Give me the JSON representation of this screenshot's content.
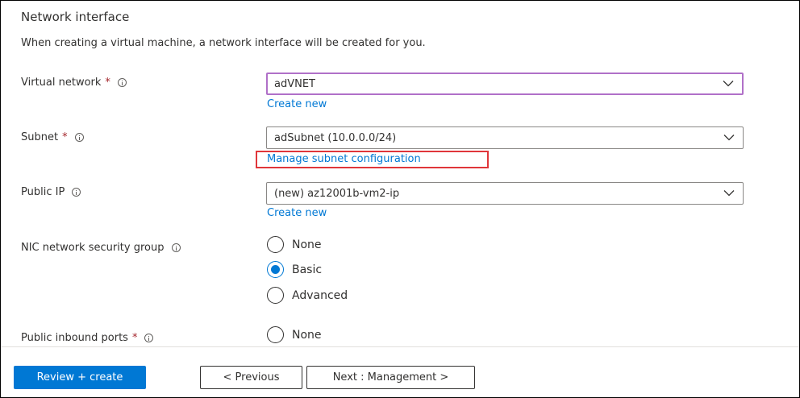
{
  "section": {
    "title": "Network interface",
    "description": "When creating a virtual machine, a network interface will be created for you."
  },
  "fields": {
    "virtual_network": {
      "label": "Virtual network",
      "required_mark": "*",
      "value": "adVNET",
      "link": "Create new"
    },
    "subnet": {
      "label": "Subnet",
      "required_mark": "*",
      "value": "adSubnet (10.0.0.0/24)",
      "link": "Manage subnet configuration"
    },
    "public_ip": {
      "label": "Public IP",
      "value": "(new) az12001b-vm2-ip",
      "link": "Create new"
    },
    "nic_nsg": {
      "label": "NIC network security group",
      "options": [
        "None",
        "Basic",
        "Advanced"
      ],
      "selected": "Basic"
    },
    "public_inbound_ports": {
      "label": "Public inbound ports",
      "required_mark": "*",
      "options": [
        "None"
      ]
    }
  },
  "footer": {
    "review_create": "Review + create",
    "previous": "< Previous",
    "next": "Next : Management >"
  },
  "colors": {
    "accent": "#0078d4",
    "required": "#a4262c",
    "highlight": "#e0363a",
    "focus_border": "#b070c8"
  }
}
